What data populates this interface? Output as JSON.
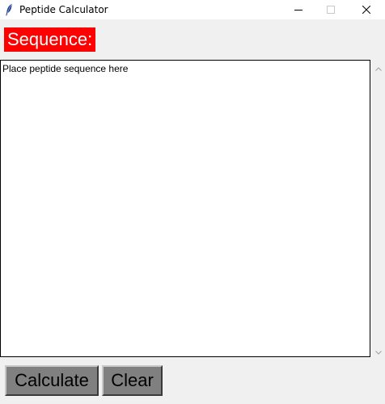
{
  "window": {
    "title": "Peptide Calculator"
  },
  "sequence": {
    "label": "Sequence:",
    "label_bg": "#ff0000",
    "label_fg": "#ffffff",
    "placeholder_text": "Place peptide sequence here"
  },
  "buttons": {
    "calculate_label": "Calculate",
    "clear_label": "Clear",
    "button_bg": "#808080"
  },
  "icons": {
    "app": "feather-icon",
    "minimize": "minimize-icon",
    "maximize": "maximize-icon",
    "close": "close-icon",
    "scroll_up": "chevron-up-icon",
    "scroll_down": "chevron-down-icon"
  }
}
